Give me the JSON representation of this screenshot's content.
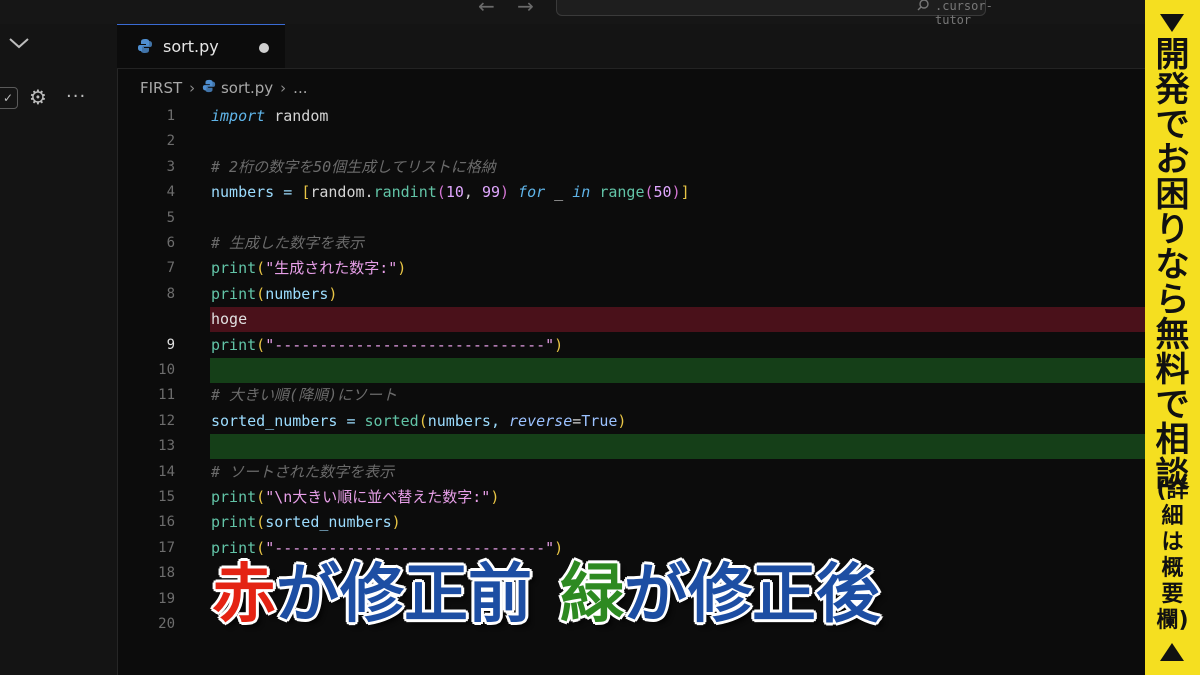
{
  "titlebar": {
    "nav_arrows": "← →",
    "search_text": ".cursor-tutor"
  },
  "tab": {
    "label": "sort.py"
  },
  "breadcrumb": {
    "folder": "FIRST",
    "file": "sort.py",
    "more": "..."
  },
  "code_lines": [
    {
      "n": "1"
    },
    {
      "n": "2"
    },
    {
      "n": "3"
    },
    {
      "n": "4"
    },
    {
      "n": "5"
    },
    {
      "n": "6"
    },
    {
      "n": "7"
    },
    {
      "n": "8"
    },
    {
      "n": "9"
    },
    {
      "n": "10"
    },
    {
      "n": "11"
    },
    {
      "n": "12"
    },
    {
      "n": "13"
    },
    {
      "n": "14"
    },
    {
      "n": "15"
    },
    {
      "n": "16"
    },
    {
      "n": "17"
    },
    {
      "n": "18"
    },
    {
      "n": "19"
    },
    {
      "n": "20"
    }
  ],
  "code": {
    "l1_kw": "import",
    "l1_rest": " random",
    "l3": "# 2桁の数字を50個生成してリストに格納",
    "l4_a": "numbers = ",
    "l4_b": "[",
    "l4_c": "random.",
    "l4_d": "randint",
    "l4_e": "(",
    "l4_f": "10",
    "l4_g": ", ",
    "l4_h": "99",
    "l4_i": ")",
    "l4_j": " for",
    "l4_k": " _ ",
    "l4_l": "in",
    "l4_m": " range",
    "l4_n": "(",
    "l4_o": "50",
    "l4_p": ")",
    "l4_q": "]",
    "l6": "# 生成した数字を表示",
    "l7_a": "print",
    "l7_b": "(",
    "l7_c": "\"生成された数字:\"",
    "l7_d": ")",
    "l8_a": "print",
    "l8_b": "(",
    "l8_c": "numbers",
    "l8_d": ")",
    "deleted": "hoge",
    "l9_a": "print",
    "l9_b": "(",
    "l9_c": "\"------------------------------\"",
    "l9_d": ")",
    "l11": "# 大きい順(降順)にソート",
    "l12_a": "sorted_numbers = ",
    "l12_b": "sorted",
    "l12_c": "(",
    "l12_d": "numbers, ",
    "l12_e": "reverse",
    "l12_f": "=",
    "l12_g": "True",
    "l12_h": ")",
    "l14": "# ソートされた数字を表示",
    "l15_a": "print",
    "l15_b": "(",
    "l15_c": "\"\\n大きい順に並べ替えた数字:\"",
    "l15_d": ")",
    "l16_a": "print",
    "l16_b": "(",
    "l16_c": "sorted_numbers",
    "l16_d": ")",
    "l17_a": "print",
    "l17_b": "(",
    "l17_c": "\"------------------------------\"",
    "l17_d": ")"
  },
  "banner": {
    "main": "開発でお困りなら無料で相談",
    "sub": "(詳細は概要欄)"
  },
  "caption": {
    "red_word": "赤",
    "part1": "が修正前",
    "green_word": "緑",
    "part2": "が修正後"
  },
  "colors": {
    "deleted_bg": "#4a111a",
    "added_bg": "#153f18",
    "banner_bg": "#f5df20",
    "caption_red": "#e42313",
    "caption_blue": "#1d4ea3",
    "caption_green": "#2d8a21"
  }
}
